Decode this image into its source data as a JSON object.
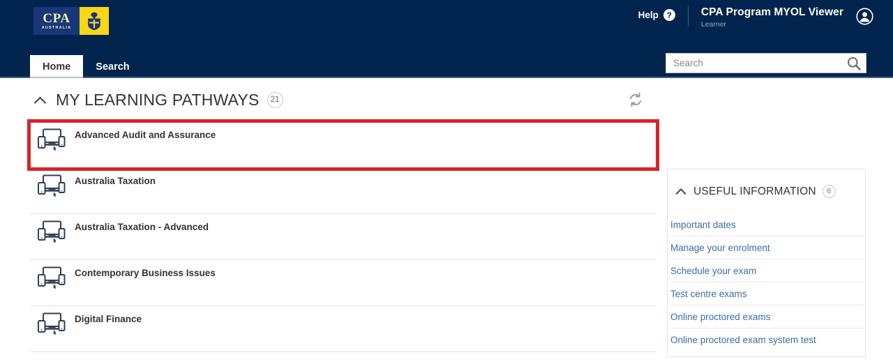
{
  "header": {
    "logo": {
      "brand": "CPA",
      "country": "AUSTRALIA",
      "crest_icon": "crest-icon"
    },
    "help_label": "Help",
    "help_icon": "question-mark-icon",
    "app_title": "CPA Program MYOL Viewer",
    "app_subtitle": "Learner",
    "avatar_icon": "user-account-icon",
    "tabs": [
      {
        "label": "Home",
        "active": true
      },
      {
        "label": "Search",
        "active": false
      }
    ],
    "search": {
      "placeholder": "Search",
      "value": "",
      "icon": "search-icon"
    }
  },
  "main": {
    "panel_title": "MY LEARNING PATHWAYS",
    "panel_count": "21",
    "collapse_icon": "chevron-up-icon",
    "refresh_icon": "refresh-icon",
    "rows": [
      {
        "label": "Advanced Audit and Assurance",
        "icon": "multi-device-icon",
        "highlighted": true
      },
      {
        "label": "Australia Taxation",
        "icon": "multi-device-icon",
        "highlighted": false
      },
      {
        "label": "Australia Taxation - Advanced",
        "icon": "multi-device-icon",
        "highlighted": false
      },
      {
        "label": "Contemporary Business Issues",
        "icon": "multi-device-icon",
        "highlighted": false
      },
      {
        "label": "Digital Finance",
        "icon": "multi-device-icon",
        "highlighted": false
      }
    ]
  },
  "sidebar": {
    "title": "USEFUL INFORMATION",
    "count": "6",
    "collapse_icon": "chevron-up-icon",
    "links": [
      {
        "label": "Important dates"
      },
      {
        "label": "Manage your enrolment"
      },
      {
        "label": "Schedule your exam"
      },
      {
        "label": "Test centre exams"
      },
      {
        "label": "Online proctored exams"
      },
      {
        "label": "Online proctored exam system test"
      }
    ]
  },
  "colors": {
    "header_navy": "#00244d",
    "logo_blue": "#17377a",
    "logo_gold": "#f9d616",
    "highlight_red": "#d8232a",
    "link_blue": "#3b6ca8"
  }
}
